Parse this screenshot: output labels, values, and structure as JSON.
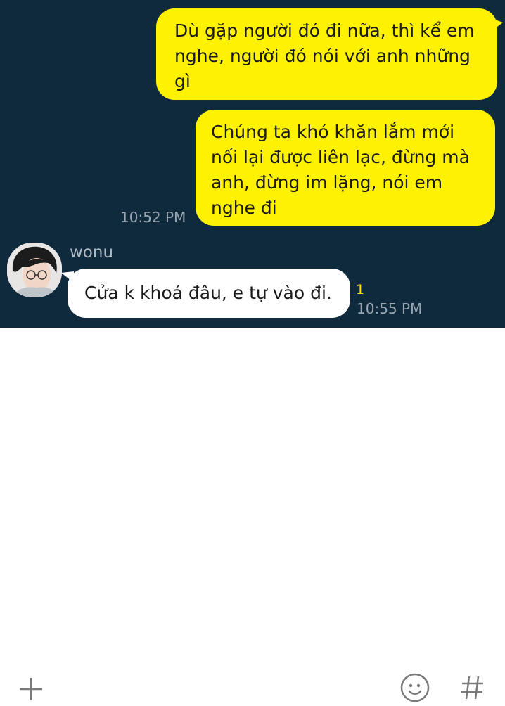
{
  "messages": [
    {
      "from": "me",
      "text": "Dù gặp người đó đi nữa, thì kể em\nnghe, người đó nói với anh những\ngì"
    },
    {
      "from": "me",
      "text": "Chúng ta khó khăn lắm mới\nnối lại được liên lạc, đừng mà\nanh, đừng im lặng, nói em\nnghe đi",
      "time": "10:52 PM"
    },
    {
      "from": "wonu",
      "sender": "wonu",
      "text": "Cửa k khoá đâu, e tự vào đi.",
      "unread": "1",
      "time": "10:55 PM"
    }
  ],
  "colors": {
    "background": "#0f2a3d",
    "my_bubble": "#fff200",
    "their_bubble": "#ffffff",
    "unread": "#ffe600"
  },
  "input_bar": {
    "icons": [
      "plus-icon",
      "emoji-icon",
      "hash-icon"
    ]
  }
}
